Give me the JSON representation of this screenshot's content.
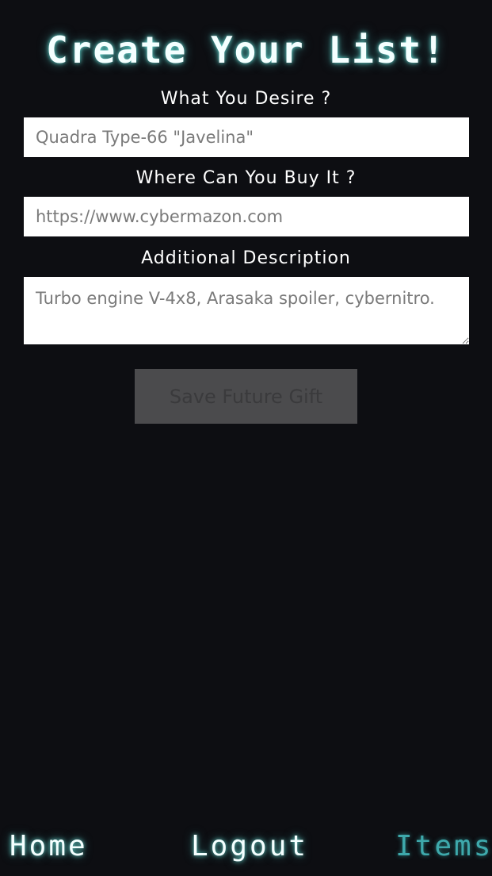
{
  "header": {
    "title": "Create Your List!"
  },
  "form": {
    "desire": {
      "label": "What You Desire ?",
      "placeholder": "Quadra Type-66 \"Javelina\""
    },
    "where": {
      "label": "Where Can You Buy It ?",
      "placeholder": "https://www.cybermazon.com"
    },
    "description": {
      "label": "Additional Description",
      "placeholder": "Turbo engine V-4x8, Arasaka spoiler, cybernitro."
    },
    "save_label": "Save Future Gift"
  },
  "nav": {
    "home": "Home",
    "logout": "Logout",
    "items": "Items",
    "active": "Items"
  },
  "colors": {
    "background": "#0d0e12",
    "glow": "#78fff5",
    "active_nav": "#3ea9ac",
    "button_disabled": "#4b4b4d"
  }
}
